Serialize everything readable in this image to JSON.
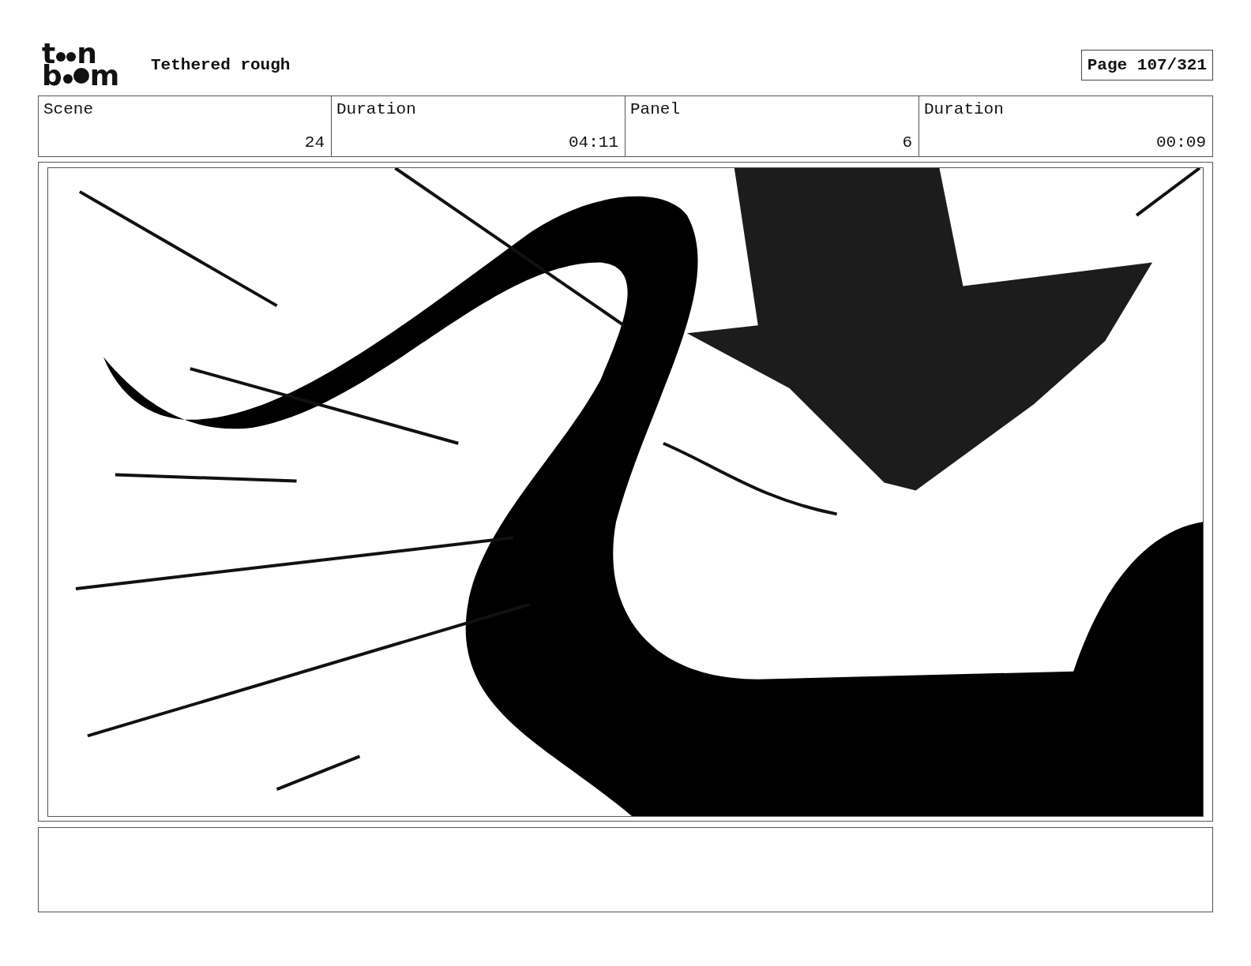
{
  "logo": {
    "top": [
      "t",
      "n"
    ],
    "bottom": [
      "b",
      "m"
    ]
  },
  "title": "Tethered rough",
  "page": "Page 107/321",
  "header_row": {
    "scene": {
      "label": "Scene",
      "number": "24"
    },
    "scene_duration": {
      "label": "Duration",
      "time": "04:11"
    },
    "panel": {
      "label": "Panel",
      "number": "6"
    },
    "panel_duration": {
      "label": "Duration",
      "time": "00:09"
    }
  }
}
